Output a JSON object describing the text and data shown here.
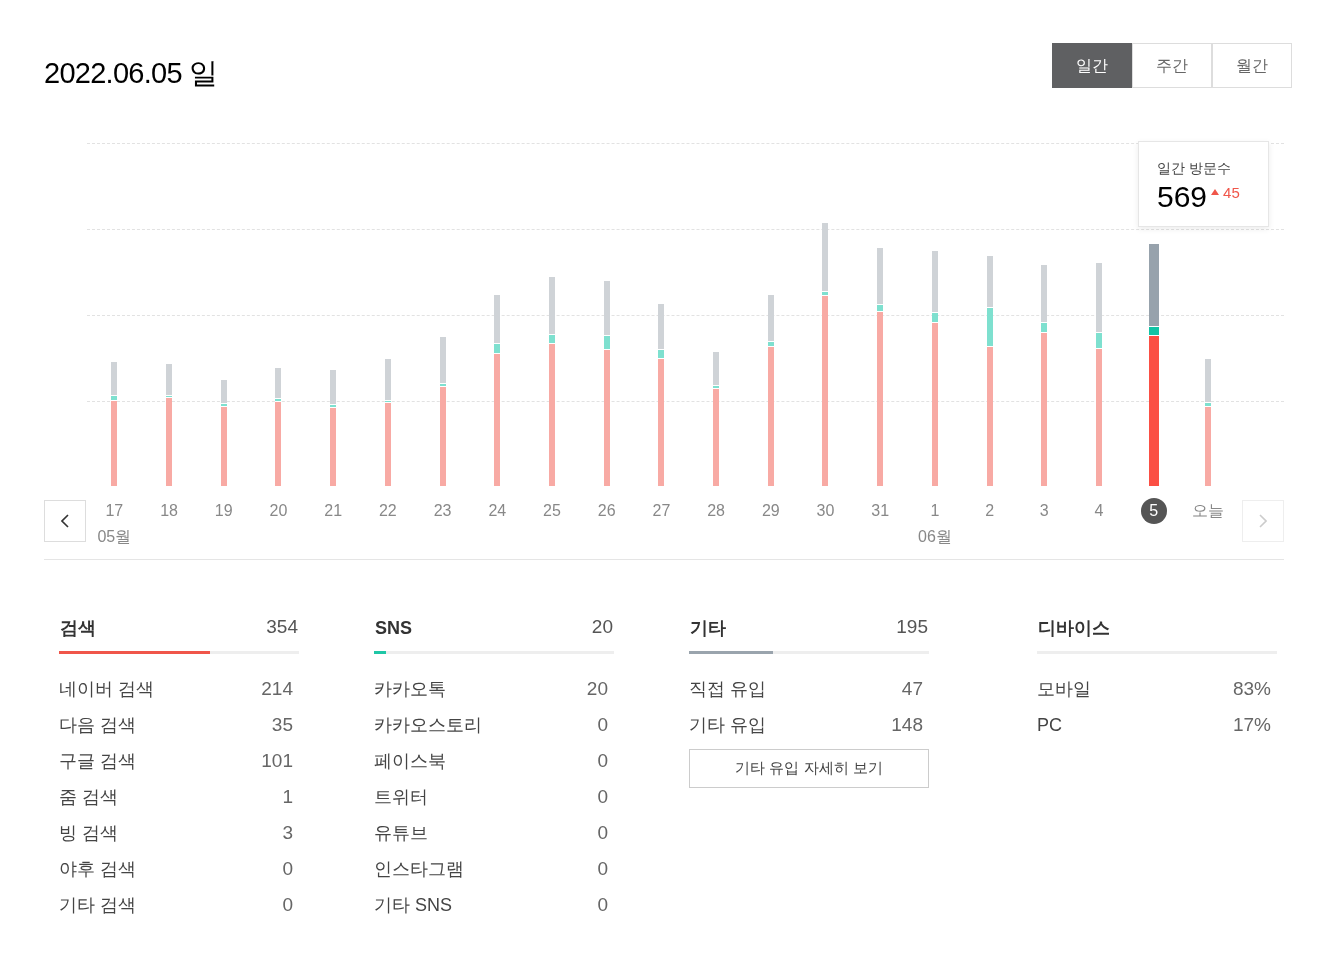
{
  "header": {
    "date": "2022.06.05 일"
  },
  "period_tabs": [
    {
      "label": "일간",
      "selected": true
    },
    {
      "label": "주간",
      "selected": false
    },
    {
      "label": "월간",
      "selected": false
    }
  ],
  "chart": {
    "tooltip": {
      "label": "일간 방문수",
      "value": "569",
      "change": "45"
    },
    "prev_button": {
      "disabled": false
    },
    "next_button": {
      "disabled": true
    },
    "days": [
      {
        "label": "17",
        "month": "05월",
        "selected": false
      },
      {
        "label": "18",
        "selected": false
      },
      {
        "label": "19",
        "selected": false
      },
      {
        "label": "20",
        "selected": false
      },
      {
        "label": "21",
        "selected": false
      },
      {
        "label": "22",
        "selected": false
      },
      {
        "label": "23",
        "selected": false
      },
      {
        "label": "24",
        "selected": false
      },
      {
        "label": "25",
        "selected": false
      },
      {
        "label": "26",
        "selected": false
      },
      {
        "label": "27",
        "selected": false
      },
      {
        "label": "28",
        "selected": false
      },
      {
        "label": "29",
        "selected": false
      },
      {
        "label": "30",
        "selected": false
      },
      {
        "label": "31",
        "selected": false
      },
      {
        "label": "1",
        "month": "06월",
        "selected": false
      },
      {
        "label": "2",
        "selected": false
      },
      {
        "label": "3",
        "selected": false
      },
      {
        "label": "4",
        "selected": false
      },
      {
        "label": "5",
        "selected": true
      },
      {
        "label": "오늘",
        "selected": false
      }
    ]
  },
  "categories": [
    {
      "title": "검색",
      "total": "354",
      "level": 0.63,
      "color": "#f0564a",
      "rows": [
        {
          "label": "네이버 검색",
          "value": "214"
        },
        {
          "label": "다음 검색",
          "value": "35"
        },
        {
          "label": "구글 검색",
          "value": "101"
        },
        {
          "label": "줌 검색",
          "value": "1"
        },
        {
          "label": "빙 검색",
          "value": "3"
        },
        {
          "label": "야후 검색",
          "value": "0"
        },
        {
          "label": "기타 검색",
          "value": "0"
        }
      ]
    },
    {
      "title": "SNS",
      "total": "20",
      "level": 0.05,
      "color": "#1fc6a6",
      "rows": [
        {
          "label": "카카오톡",
          "value": "20"
        },
        {
          "label": "카카오스토리",
          "value": "0"
        },
        {
          "label": "페이스북",
          "value": "0"
        },
        {
          "label": "트위터",
          "value": "0"
        },
        {
          "label": "유튜브",
          "value": "0"
        },
        {
          "label": "인스타그램",
          "value": "0"
        },
        {
          "label": "기타 SNS",
          "value": "0"
        }
      ]
    },
    {
      "title": "기타",
      "total": "195",
      "level": 0.35,
      "color": "#9aa4ad",
      "rows": [
        {
          "label": "직접 유입",
          "value": "47"
        },
        {
          "label": "기타 유입",
          "value": "148"
        }
      ],
      "button": "기타 유입 자세히 보기"
    },
    {
      "title": "디바이스",
      "rows": [
        {
          "label": "모바일",
          "value": "83%"
        },
        {
          "label": "PC",
          "value": "17%"
        }
      ]
    }
  ]
}
